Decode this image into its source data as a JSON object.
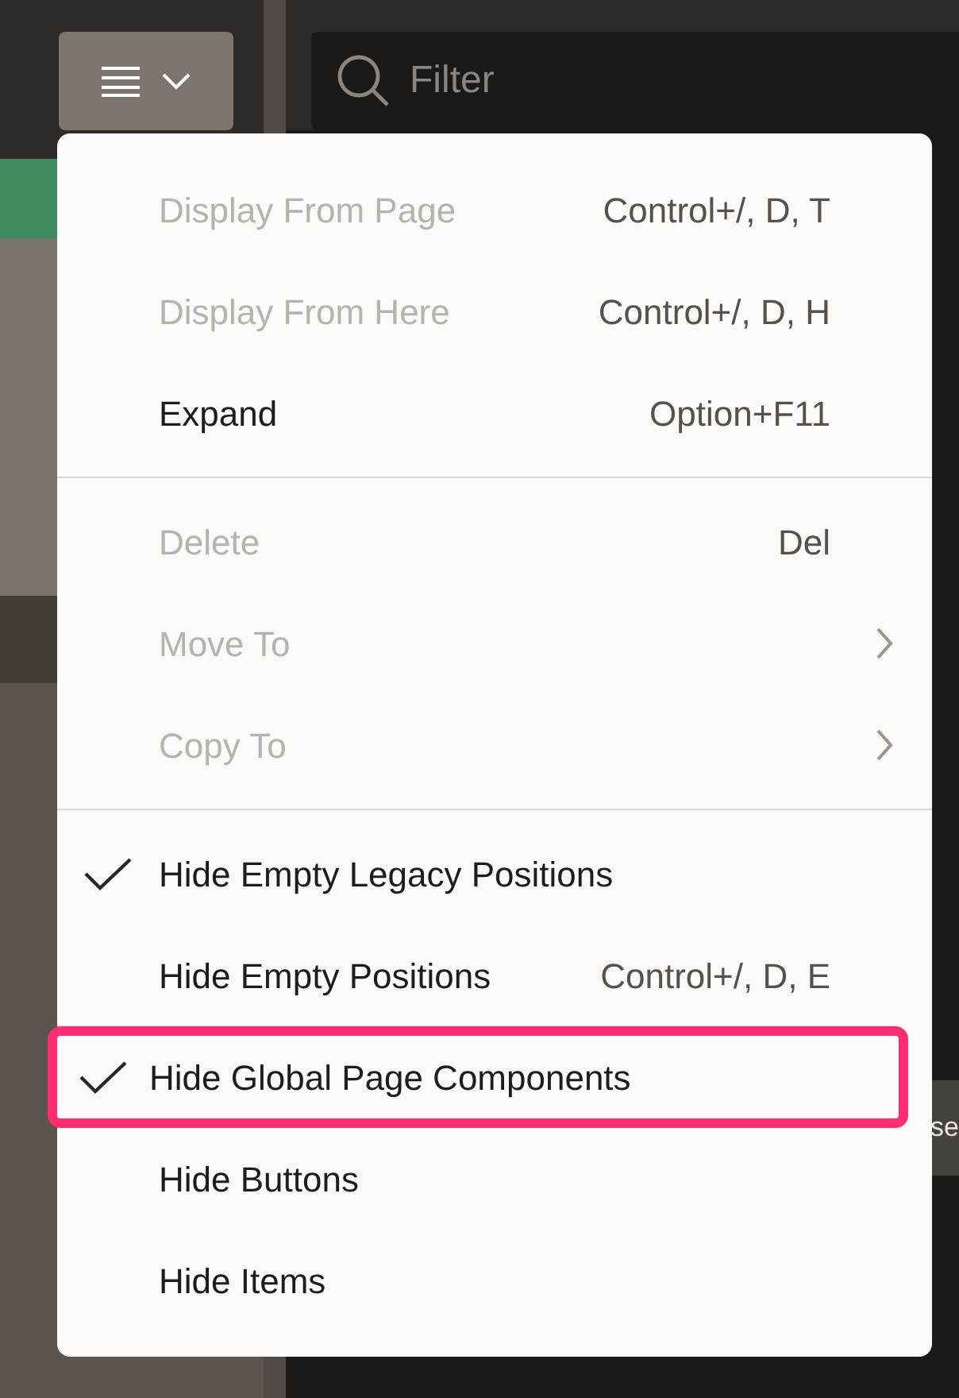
{
  "toolbar": {
    "filter": {
      "placeholder": "Filter"
    }
  },
  "background_text": "se",
  "menu": {
    "sections": [
      {
        "items": [
          {
            "label": "Display From Page",
            "shortcut": "Control+/, D, T",
            "disabled": true,
            "checked": false,
            "submenu": false,
            "highlighted": false
          },
          {
            "label": "Display From Here",
            "shortcut": "Control+/, D, H",
            "disabled": true,
            "checked": false,
            "submenu": false,
            "highlighted": false
          },
          {
            "label": "Expand",
            "shortcut": "Option+F11",
            "disabled": false,
            "checked": false,
            "submenu": false,
            "highlighted": false
          }
        ]
      },
      {
        "items": [
          {
            "label": "Delete",
            "shortcut": "Del",
            "disabled": true,
            "checked": false,
            "submenu": false,
            "highlighted": false
          },
          {
            "label": "Move To",
            "disabled": true,
            "checked": false,
            "submenu": true,
            "highlighted": false
          },
          {
            "label": "Copy To",
            "disabled": true,
            "checked": false,
            "submenu": true,
            "highlighted": false
          }
        ]
      },
      {
        "items": [
          {
            "label": "Hide Empty Legacy Positions",
            "disabled": false,
            "checked": true,
            "submenu": false,
            "highlighted": false
          },
          {
            "label": "Hide Empty Positions",
            "shortcut": "Control+/, D, E",
            "disabled": false,
            "checked": false,
            "submenu": false,
            "highlighted": false
          },
          {
            "label": "Hide Global Page Components",
            "disabled": false,
            "checked": true,
            "submenu": false,
            "highlighted": true
          },
          {
            "label": "Hide Buttons",
            "disabled": false,
            "checked": false,
            "submenu": false,
            "highlighted": false
          },
          {
            "label": "Hide Items",
            "disabled": false,
            "checked": false,
            "submenu": false,
            "highlighted": false
          }
        ]
      }
    ]
  }
}
